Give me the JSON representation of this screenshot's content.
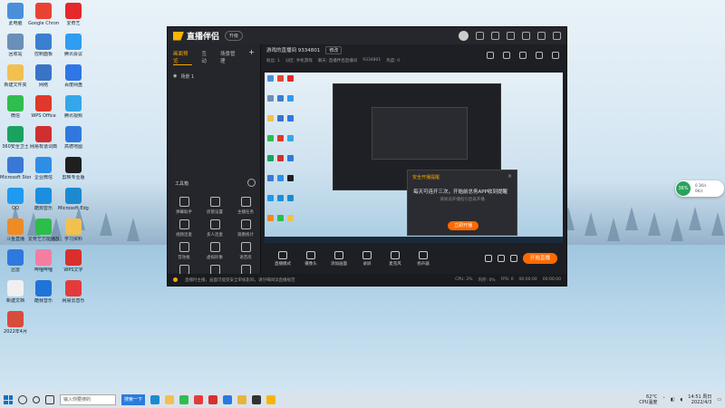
{
  "desktop_icons": [
    {
      "label": "此电脑",
      "color": "#4a90d9"
    },
    {
      "label": "Google Chrome",
      "color": "#e94235"
    },
    {
      "label": "爱奇艺",
      "color": "#e6272b"
    },
    {
      "label": "回收站",
      "color": "#6a8fb8"
    },
    {
      "label": "控制面板",
      "color": "#3a7fd0"
    },
    {
      "label": "腾讯会议",
      "color": "#2f9df0"
    },
    {
      "label": "新建文件夹",
      "color": "#f2c04e"
    },
    {
      "label": "网络",
      "color": "#3874c6"
    },
    {
      "label": "百度网盘",
      "color": "#2f76e6"
    },
    {
      "label": "微信",
      "color": "#2ebd4e"
    },
    {
      "label": "WPS Office",
      "color": "#e0382c"
    },
    {
      "label": "腾讯视频",
      "color": "#34a7ea"
    },
    {
      "label": "360安全卫士",
      "color": "#1aa260"
    },
    {
      "label": "网易有道词典",
      "color": "#d12f2f"
    },
    {
      "label": "高德地图",
      "color": "#2f79de"
    },
    {
      "label": "Microsoft Store",
      "color": "#3b78d6"
    },
    {
      "label": "企业微信",
      "color": "#2e8ee6"
    },
    {
      "label": "剪映专业版",
      "color": "#1f1f1f"
    },
    {
      "label": "QQ",
      "color": "#1d9bf0"
    },
    {
      "label": "酷狗音乐",
      "color": "#1b8ee0"
    },
    {
      "label": "Microsoft Edge",
      "color": "#1d8ad0"
    },
    {
      "label": "斗鱼直播",
      "color": "#f08a24"
    },
    {
      "label": "爱奇艺万能播放器",
      "color": "#2cbd4a"
    },
    {
      "label": "学习资料",
      "color": "#f2c04e"
    },
    {
      "label": "迅雷",
      "color": "#2f79de"
    },
    {
      "label": "哔哩哔哩",
      "color": "#f47ea0"
    },
    {
      "label": "WPS文字",
      "color": "#d9302b"
    },
    {
      "label": "新建文档",
      "color": "#f0f0f0"
    },
    {
      "label": "酷我音乐",
      "color": "#1f74d8"
    },
    {
      "label": "网易云音乐",
      "color": "#e33b3b"
    },
    {
      "label": "2022年4月",
      "color": "#d94b3b"
    }
  ],
  "app": {
    "title": "直播伴侣",
    "version": "升级",
    "left_tabs": [
      "画面预览",
      "互动",
      "场景管理"
    ],
    "scene_label": "场景 1",
    "tools_header": "工具箱",
    "tools": [
      "弹幕助手",
      "房管设置",
      "主播任务",
      "视频连麦",
      "多人连麦",
      "观看统计",
      "音效板",
      "虚拟形象",
      "语音房",
      "直播数据",
      "直播间管理",
      "导出"
    ],
    "room_title": "游戏的直播间 9334801",
    "edit_label": "修改",
    "room_meta": [
      "粉丝: 1",
      "分区: 手机游戏",
      "聊天: 直播伴侣直播间",
      "9334801",
      "热度: 0"
    ],
    "bottom_tools": [
      "直播模式",
      "摄像头",
      "添加画面",
      "录屏",
      "麦克风",
      "扬声器"
    ],
    "live_button": "开始直播",
    "status_text": "直播时主播，画面可能受安全审核影响，请仔细阅读直播规范",
    "status_right": [
      "CPU: 2%",
      "内存: 0%",
      "FPS: 0",
      "00:00:00",
      "00:00:00"
    ]
  },
  "dialog": {
    "title": "安全开播提醒",
    "close": "×",
    "message": "每天可连开三次，开始前总务APP收到提醒",
    "sub": "请阅读开播指引后再开播",
    "button": "立即开播"
  },
  "widget": {
    "percent": "36%",
    "line1": "0.1K/s",
    "line2": "0K/s"
  },
  "taskbar": {
    "search_placeholder": "输入你要搜的",
    "search_button": "搜索一下",
    "weather": "62°C",
    "cpu": "CPU温度",
    "time": "14:51 周日",
    "date": "2022/4/3"
  }
}
